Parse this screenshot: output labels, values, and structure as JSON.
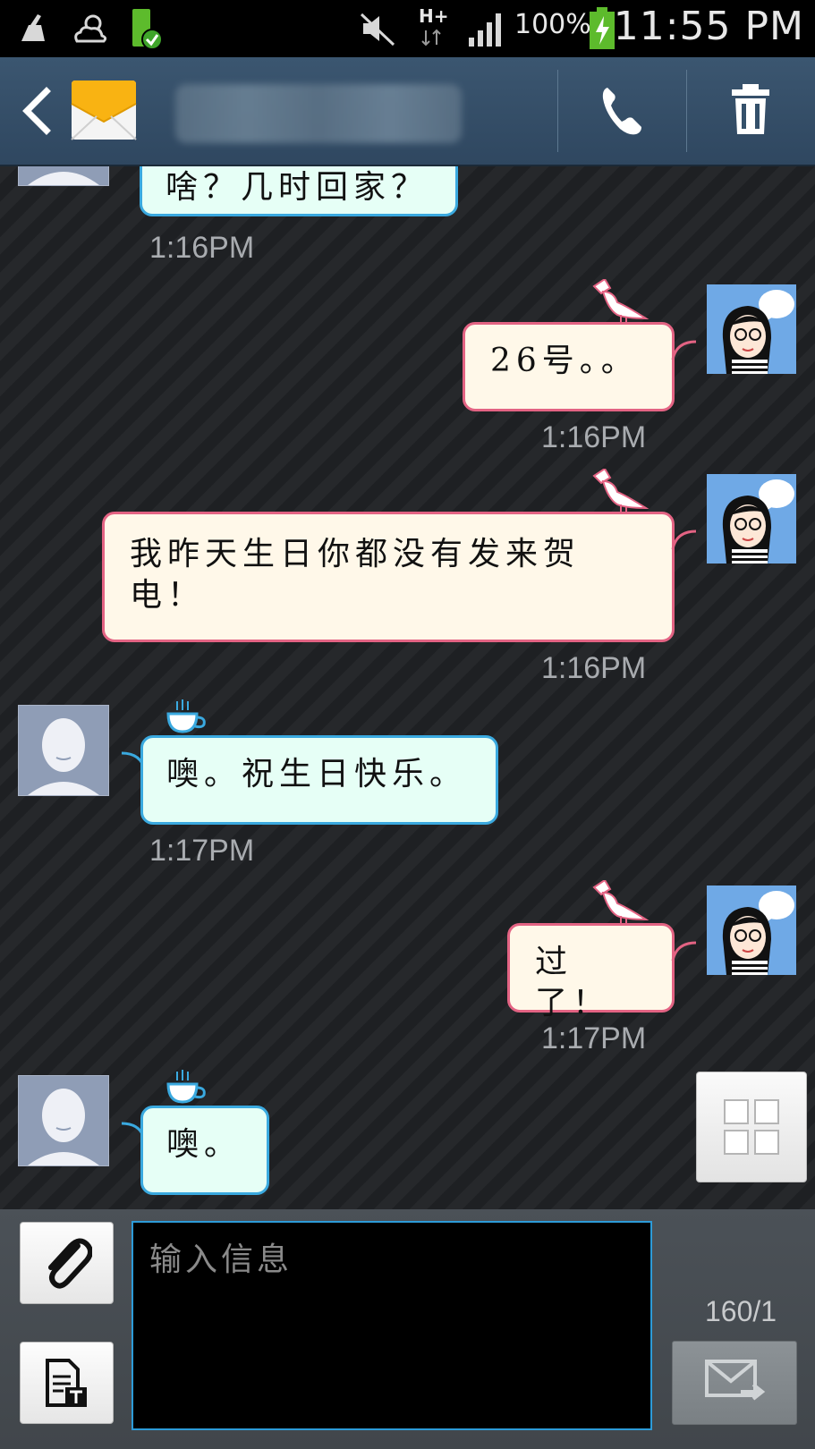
{
  "status_bar": {
    "battery_percent": "100%",
    "time": "11:55 PM",
    "network": "H+"
  },
  "header": {
    "contact_name": "",
    "call_icon": "phone-icon",
    "delete_icon": "trash-icon"
  },
  "messages": [
    {
      "direction": "in",
      "text": "啥？几时回家？",
      "time": "1:16PM"
    },
    {
      "direction": "out",
      "text": "26号。。",
      "time": "1:16PM"
    },
    {
      "direction": "out",
      "text": "我昨天生日你都没有发来贺电！",
      "time": "1:16PM"
    },
    {
      "direction": "in",
      "text": "噢。祝生日快乐。",
      "time": "1:17PM"
    },
    {
      "direction": "out",
      "text": "过了！",
      "time": "1:17PM"
    },
    {
      "direction": "in",
      "text": "噢。",
      "time": ""
    }
  ],
  "composer": {
    "placeholder": "输入信息",
    "counter": "160/1"
  },
  "colors": {
    "incoming_border": "#3aa9df",
    "incoming_fill": "#e6fff6",
    "outgoing_border": "#e36383",
    "outgoing_fill": "#fff8e9",
    "header_bg": "#34506a"
  }
}
